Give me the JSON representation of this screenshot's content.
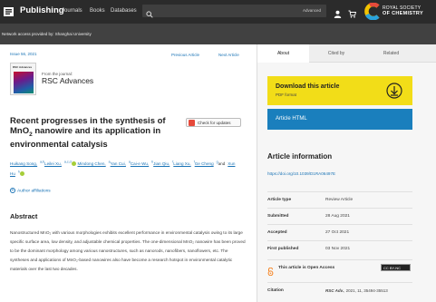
{
  "header": {
    "brand": "Publishing",
    "nav": [
      "Journals",
      "Books",
      "Databases"
    ],
    "search": {
      "placeholder": "",
      "advanced": "Advanced"
    },
    "logo": {
      "line1": "ROYAL SOCIETY",
      "line2": "OF CHEMISTRY"
    },
    "access": "Network access provided by: Shanghai University"
  },
  "article": {
    "issue_date": "Issue 56, 2021",
    "previous": "Previous Article",
    "next": "Next Article",
    "cover_title": "RSC Advances",
    "from_journal": "From the journal:",
    "journal": "RSC Advances",
    "title_parts": {
      "a": "Recent progresses in the synthesis of MnO",
      "sub": "2",
      "b": " nanowire and its application in environmental catalysis"
    },
    "check_updates": "Check for updates",
    "authors": [
      {
        "name": "Huikang Song,",
        "sup": "a,b",
        "orcid": false
      },
      {
        "name": "Leilei Xu,",
        "sup": "a,c,d",
        "orcid": true
      },
      {
        "name": "Mindong Chen,",
        "sup": "a",
        "orcid": false
      },
      {
        "name": "Yan Cui,",
        "sup": "a",
        "orcid": false
      },
      {
        "name": "Cai-e Wu,",
        "sup": "b",
        "orcid": false
      },
      {
        "name": "Jian Qiu,",
        "sup": "f",
        "orcid": false
      },
      {
        "name": "Liang Xu,",
        "sup": "f",
        "orcid": false
      },
      {
        "name": "Ge Cheng",
        "sup": "g",
        "orcid": false
      }
    ],
    "author_and": "and",
    "last_author": {
      "name": "Xun Hu",
      "sup": "h",
      "orcid": true
    },
    "affiliations": "Author affiliations",
    "abstract_heading": "Abstract",
    "abstract": "Nanostructured MnO₂ with various morphologies exhibits excellent performance in environmental catalysis owing to its large specific surface area, low density, and adjustable chemical properties. The one-dimensional MnO₂ nanowire has been proved to be the dominant morphology among various nanostructures, such as nanorods, nanofibers, nanoflowers, etc. The syntheses and applications of MnO₂-based nanowires also have become a research hotspot in environmental catalytic materials over the last two decades."
  },
  "sidebar": {
    "tabs": [
      "About",
      "Cited by",
      "Related"
    ],
    "active_tab": 0,
    "download_title": "Download this article",
    "download_sub": "PDF format",
    "html_label": "Article HTML",
    "info_heading": "Article information",
    "doi": "https://doi.org/10.1039/D1RA06497E",
    "info_rows": [
      {
        "k": "Article type",
        "v": "Review Article"
      },
      {
        "k": "Submitted",
        "v": "28 Aug 2021"
      },
      {
        "k": "Accepted",
        "v": "27 Oct 2021"
      },
      {
        "k": "First published",
        "v": "03 Nov 2021"
      }
    ],
    "open_access": "This article is Open Access",
    "cc_label": "CC BY-NC",
    "citation_label": "Citation",
    "citation_journal": "RSC Adv.",
    "citation_rest": ", 2021, 11, 35494-35513"
  },
  "colors": {
    "download_bg": "#f2dd18",
    "html_bg": "#1a7fbd",
    "link": "#1b74b6",
    "topbar": "#2b2b2b"
  }
}
